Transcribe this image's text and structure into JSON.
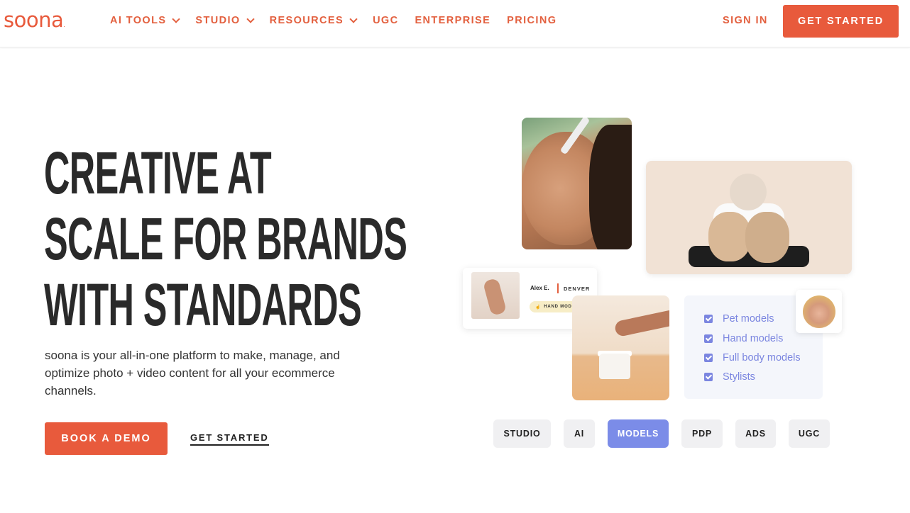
{
  "nav": {
    "logo": "soona",
    "logo_mark": ".",
    "links": [
      {
        "label": "AI TOOLS",
        "has_dropdown": true
      },
      {
        "label": "STUDIO",
        "has_dropdown": true
      },
      {
        "label": "RESOURCES",
        "has_dropdown": true
      },
      {
        "label": "UGC",
        "has_dropdown": false
      },
      {
        "label": "ENTERPRISE",
        "has_dropdown": false
      },
      {
        "label": "PRICING",
        "has_dropdown": false
      }
    ],
    "sign_in": "SIGN IN",
    "get_started": "GET STARTED"
  },
  "hero": {
    "headline_lines": [
      "CREATIVE AT",
      "SCALE FOR BRANDS",
      "WITH STANDARDS"
    ],
    "subhead": "soona is your all-in-one platform to make, manage, and optimize photo + video content for all your ecommerce channels.",
    "primary_cta": "BOOK A DEMO",
    "secondary_cta": "GET STARTED"
  },
  "collage": {
    "model_card": {
      "name": "Alex E.",
      "city": "DENVER",
      "tag": "HAND MODEL"
    },
    "checklist": [
      "Pet models",
      "Hand models",
      "Full body models",
      "Stylists"
    ]
  },
  "tabs": [
    "STUDIO",
    "AI",
    "MODELS",
    "PDP",
    "ADS",
    "UGC"
  ],
  "active_tab": "MODELS",
  "colors": {
    "brand": "#e85a3c",
    "accent": "#7b8ce8",
    "text": "#2a2a2a"
  }
}
